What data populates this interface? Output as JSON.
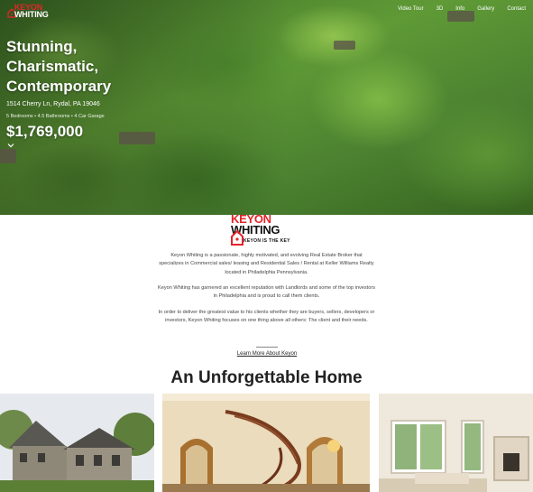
{
  "header": {
    "logo_small_text_keyon": "KEYON",
    "logo_small_text_whiting": "WHITING",
    "nav": [
      "Video Tour",
      "3D",
      "Info",
      "Gallery",
      "Contact"
    ]
  },
  "hero": {
    "title_lines": [
      "Stunning,",
      "Charismatic,",
      "Contemporary"
    ],
    "address": "1514 Cherry Ln, Rydal, PA 19046",
    "specs": "5 Bedrooms  • 4.5 Bathrooms  • 4 Car Garage",
    "price": "$1,769,000"
  },
  "brand": {
    "name_keyon": "KEYON",
    "name_whiting": "WHITING",
    "tagline": "KEYON IS THE KEY",
    "colors": {
      "red": "#e3252a",
      "dark": "#111111"
    }
  },
  "about": {
    "paragraphs": [
      "Keyon Whiting is a passionate, highly motivated, and evolving Real Estate Broker that specializes in Commercial sales/ leasing and Residential Sales / Rental at Keller Williams Realty located in Philadelphia Pennsylvania.",
      "Keyon Whiting has garnered an excellent reputation with Landlords and some of the top investors in Philadelphia and is proud to call them clients.",
      "In order to deliver the greatest value to his clients whether they are buyers, sellers, developers or investors, Keyon Whiting focuses on one thing above all others: The client and their needs."
    ],
    "learn_more": "Learn More About Keyon"
  },
  "section": {
    "title": "An Unforgettable Home"
  }
}
